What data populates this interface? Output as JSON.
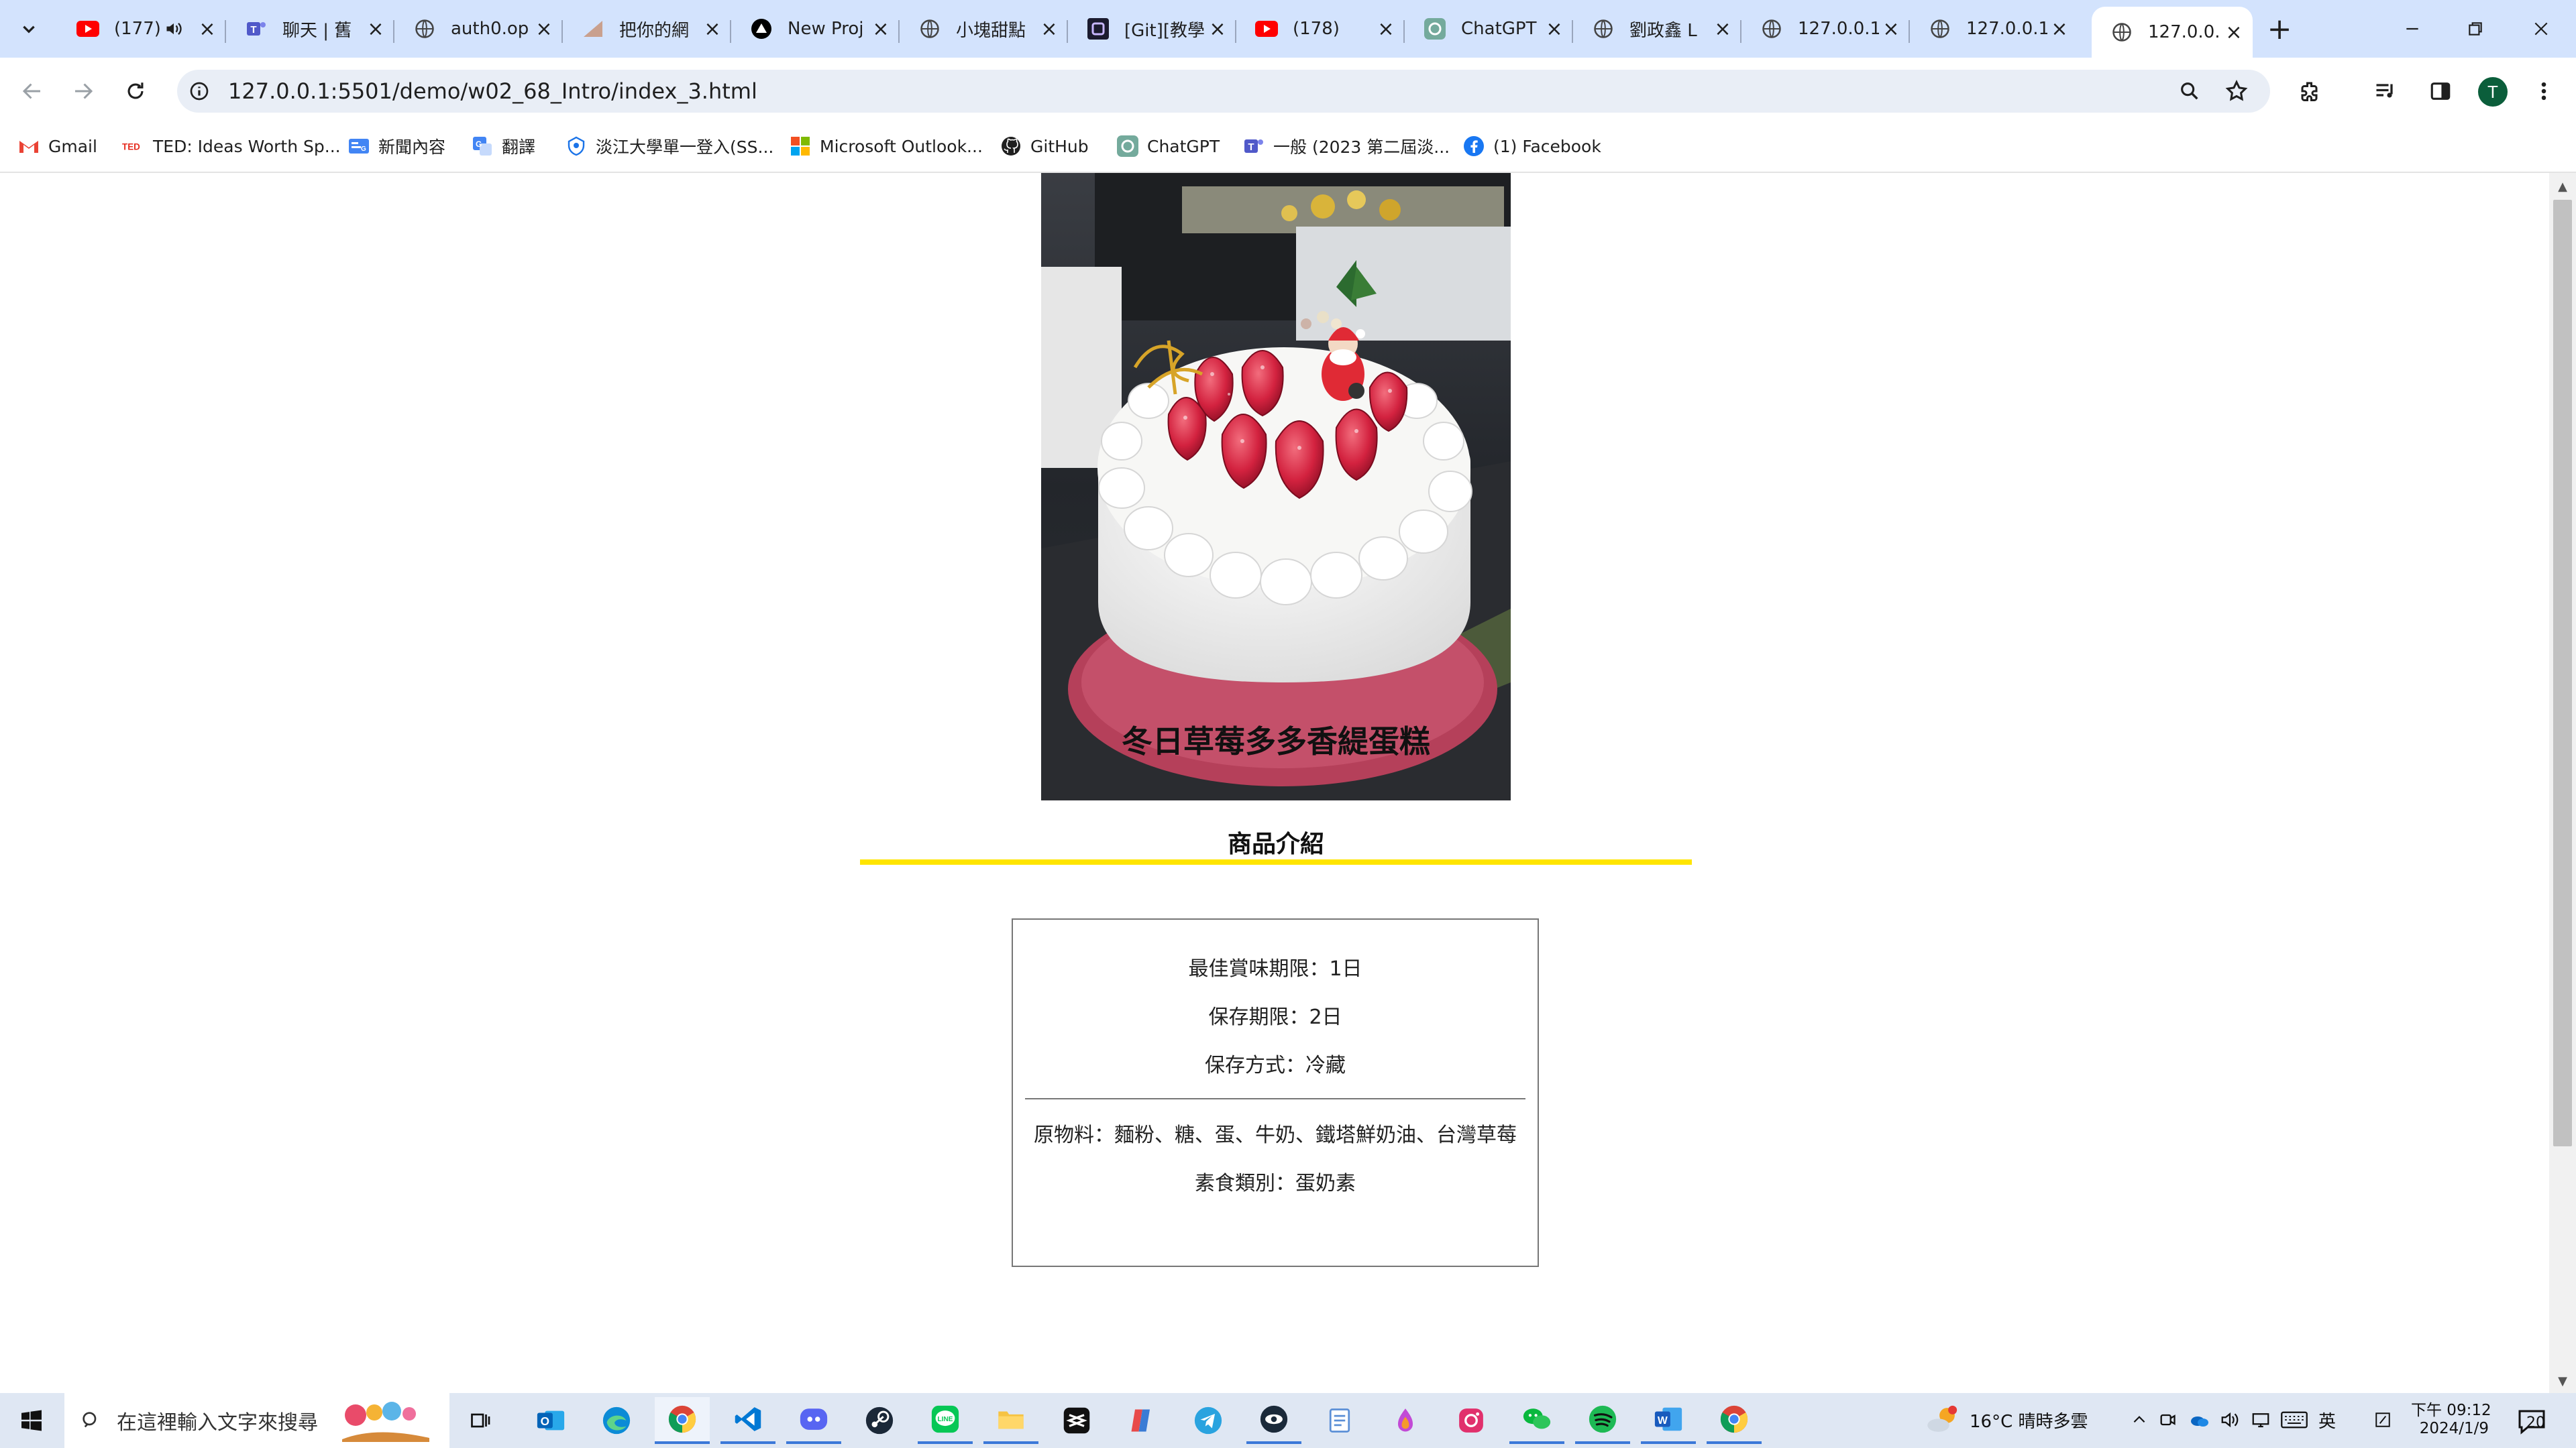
{
  "browser": {
    "tabs": [
      {
        "title": "(177)",
        "favicon": "youtube-icon",
        "audio": true
      },
      {
        "title": "聊天 | 舊",
        "favicon": "teams-icon"
      },
      {
        "title": "auth0.op",
        "favicon": "globe-icon"
      },
      {
        "title": "把你的網",
        "favicon": "triangle-icon"
      },
      {
        "title": "New Proj",
        "favicon": "vercel-icon"
      },
      {
        "title": "小塊甜點",
        "favicon": "globe-icon"
      },
      {
        "title": "[Git][教學",
        "favicon": "site-dark-icon"
      },
      {
        "title": "(178)",
        "favicon": "youtube-icon"
      },
      {
        "title": "ChatGPT",
        "favicon": "chatgpt-icon"
      },
      {
        "title": "劉政鑫 L",
        "favicon": "globe-icon"
      },
      {
        "title": "127.0.0.1",
        "favicon": "globe-icon"
      },
      {
        "title": "127.0.0.1",
        "favicon": "globe-icon"
      },
      {
        "title": "127.0.0.1",
        "favicon": "globe-icon",
        "active": true
      }
    ],
    "address": "127.0.0.1:5501/demo/w02_68_Intro/index_3.html",
    "profile_initial": "T",
    "bookmarks": [
      {
        "label": "Gmail",
        "icon": "gmail-icon"
      },
      {
        "label": "TED: Ideas Worth Sp...",
        "icon": "ted-icon"
      },
      {
        "label": "新聞內容",
        "icon": "google-news-icon"
      },
      {
        "label": "翻譯",
        "icon": "translate-icon"
      },
      {
        "label": "淡江大學單一登入(SS...",
        "icon": "tku-icon"
      },
      {
        "label": "Microsoft Outlook...",
        "icon": "microsoft-icon"
      },
      {
        "label": "GitHub",
        "icon": "github-icon"
      },
      {
        "label": "ChatGPT",
        "icon": "chatgpt-icon"
      },
      {
        "label": "一般 (2023 第二屆淡...",
        "icon": "teams-icon"
      },
      {
        "label": "(1) Facebook",
        "icon": "facebook-icon"
      }
    ]
  },
  "page": {
    "product_title": "冬日草莓多多香緹蛋糕",
    "section_heading": "商品介紹",
    "info_top": [
      "最佳賞味期限：1日",
      "保存期限：2日",
      "保存方式：冷藏"
    ],
    "info_bottom": [
      "原物料：麵粉、糖、蛋、牛奶、鐵塔鮮奶油、台灣草莓",
      "素食類別：蛋奶素"
    ]
  },
  "taskbar": {
    "search_placeholder": "在這裡輸入文字來搜尋",
    "weather": "16°C  晴時多雲",
    "ime": "英",
    "time": "下午 09:12",
    "date": "2024/1/9",
    "notification_count": "20",
    "apps": [
      "task-view-icon",
      "outlook-icon",
      "edge-icon",
      "chrome-icon",
      "vscode-icon",
      "discord-icon",
      "steam-icon",
      "line-icon",
      "file-explorer-icon",
      "capcut-icon",
      "app-icon",
      "telegram-icon",
      "app-icon",
      "notepad-icon",
      "app-icon",
      "instagram-icon",
      "wechat-icon",
      "spotify-icon",
      "word-icon",
      "chrome-icon"
    ]
  },
  "colors": {
    "accent_rule": "#ffe500",
    "tabstrip": "#d3e3fd"
  }
}
